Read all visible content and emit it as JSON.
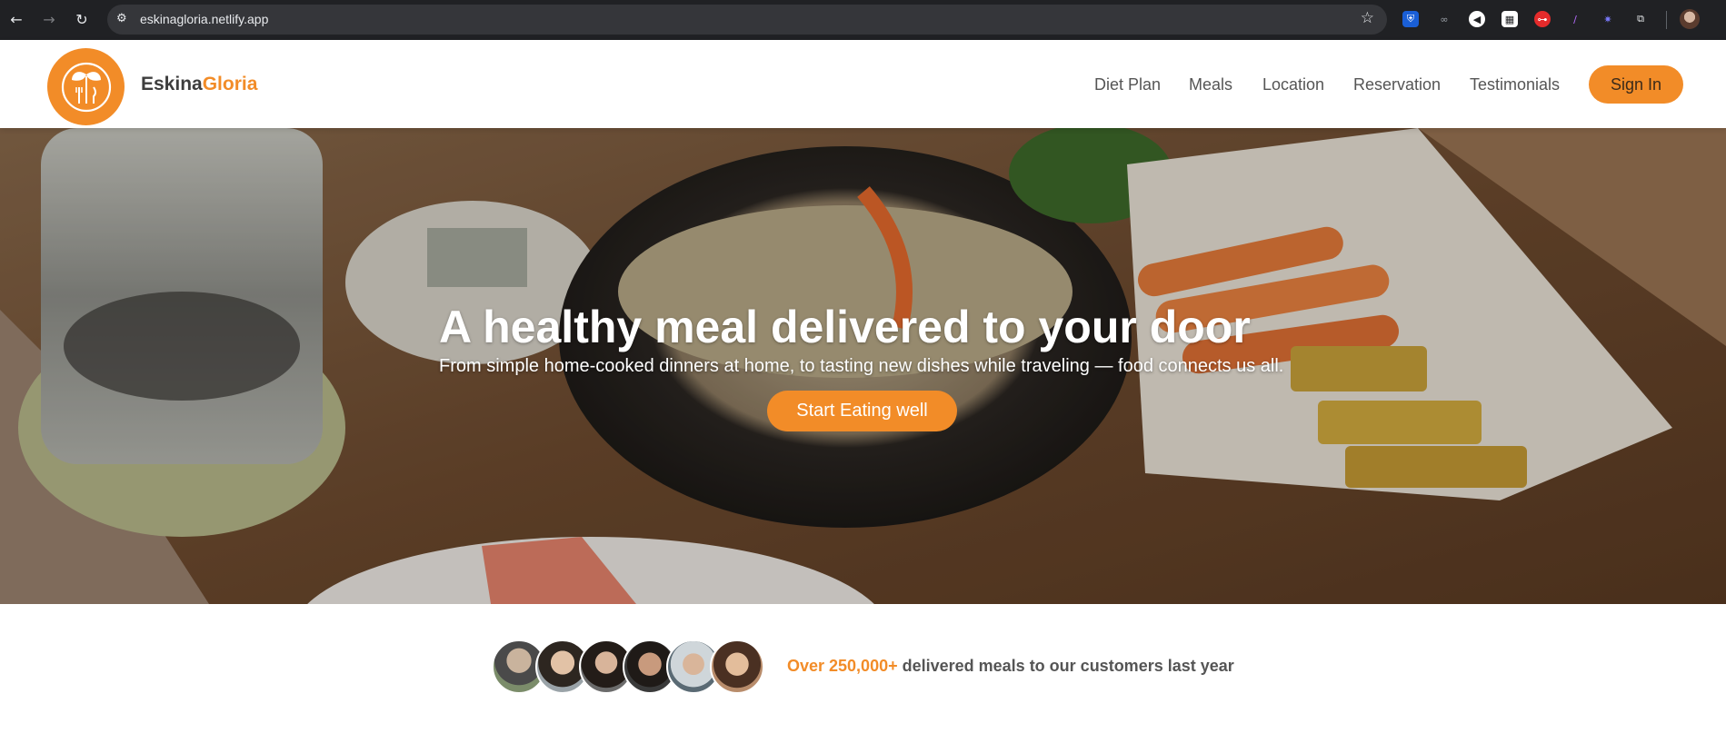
{
  "browser": {
    "url": "eskinagloria.netlify.app",
    "back_icon": "arrow-left-icon",
    "forward_icon": "arrow-right-icon",
    "reload_icon": "reload-icon",
    "bookmark_icon": "star-icon"
  },
  "header": {
    "brand_part1": "Eskina",
    "brand_part2": "Gloria",
    "nav": [
      "Diet Plan",
      "Meals",
      "Location",
      "Reservation",
      "Testimonials"
    ],
    "signin_label": "Sign In"
  },
  "hero": {
    "title": "A healthy meal delivered to your door",
    "subtitle": "From simple home-cooked dinners at home, to tasting new dishes while traveling — food connects us all.",
    "cta_label": "Start Eating well"
  },
  "proof": {
    "highlight": "Over 250,000+",
    "text": " delivered meals to our customers last year"
  },
  "colors": {
    "accent": "#f28c28",
    "chrome_bg": "#202124",
    "text": "#555555"
  }
}
